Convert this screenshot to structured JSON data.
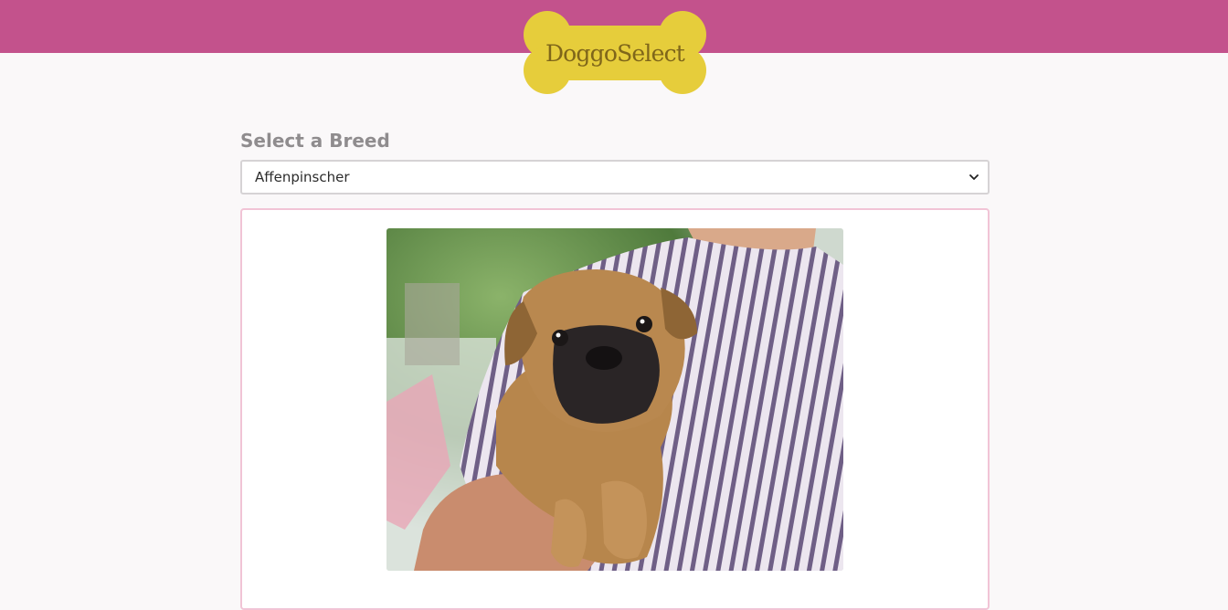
{
  "brand": {
    "logo_text": "DoggoSelect"
  },
  "form": {
    "label": "Select a Breed",
    "selected_breed": "Affenpinscher"
  },
  "card": {
    "image_alt": "Puppy being held by a person in a striped shirt",
    "caption": ""
  },
  "colors": {
    "header": "#c3528c",
    "logo": "#e6cd3b",
    "card_border": "#f1c4d6"
  }
}
